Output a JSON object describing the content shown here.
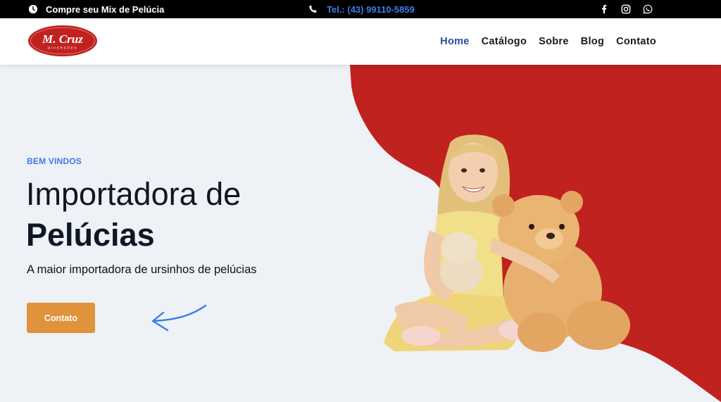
{
  "topbar": {
    "hours_icon": "clock-icon",
    "promo_text": "Compre seu Mix de Pelúcia",
    "phone_icon": "phone-icon",
    "phone_text": "Tel.: (43) 99110-5859",
    "social": [
      "facebook-icon",
      "instagram-icon",
      "whatsapp-icon"
    ]
  },
  "header": {
    "logo_text": "M. Cruz",
    "logo_subtext": "DIVERSÕES",
    "nav": [
      {
        "label": "Home",
        "active": true
      },
      {
        "label": "Catálogo",
        "active": false
      },
      {
        "label": "Sobre",
        "active": false
      },
      {
        "label": "Blog",
        "active": false
      },
      {
        "label": "Contato",
        "active": false
      }
    ]
  },
  "hero": {
    "eyebrow": "BEM VINDOS",
    "title_line1": "Importadora de",
    "title_line2": "Pelúcias",
    "subtitle": "A maior importadora de ursinhos de pelúcias",
    "cta_label": "Contato"
  },
  "colors": {
    "accent_blue": "#3b7de8",
    "nav_active": "#2b4a9b",
    "hero_red": "#c0221f",
    "cta_orange": "#e0933a",
    "background": "#eef1f6"
  }
}
